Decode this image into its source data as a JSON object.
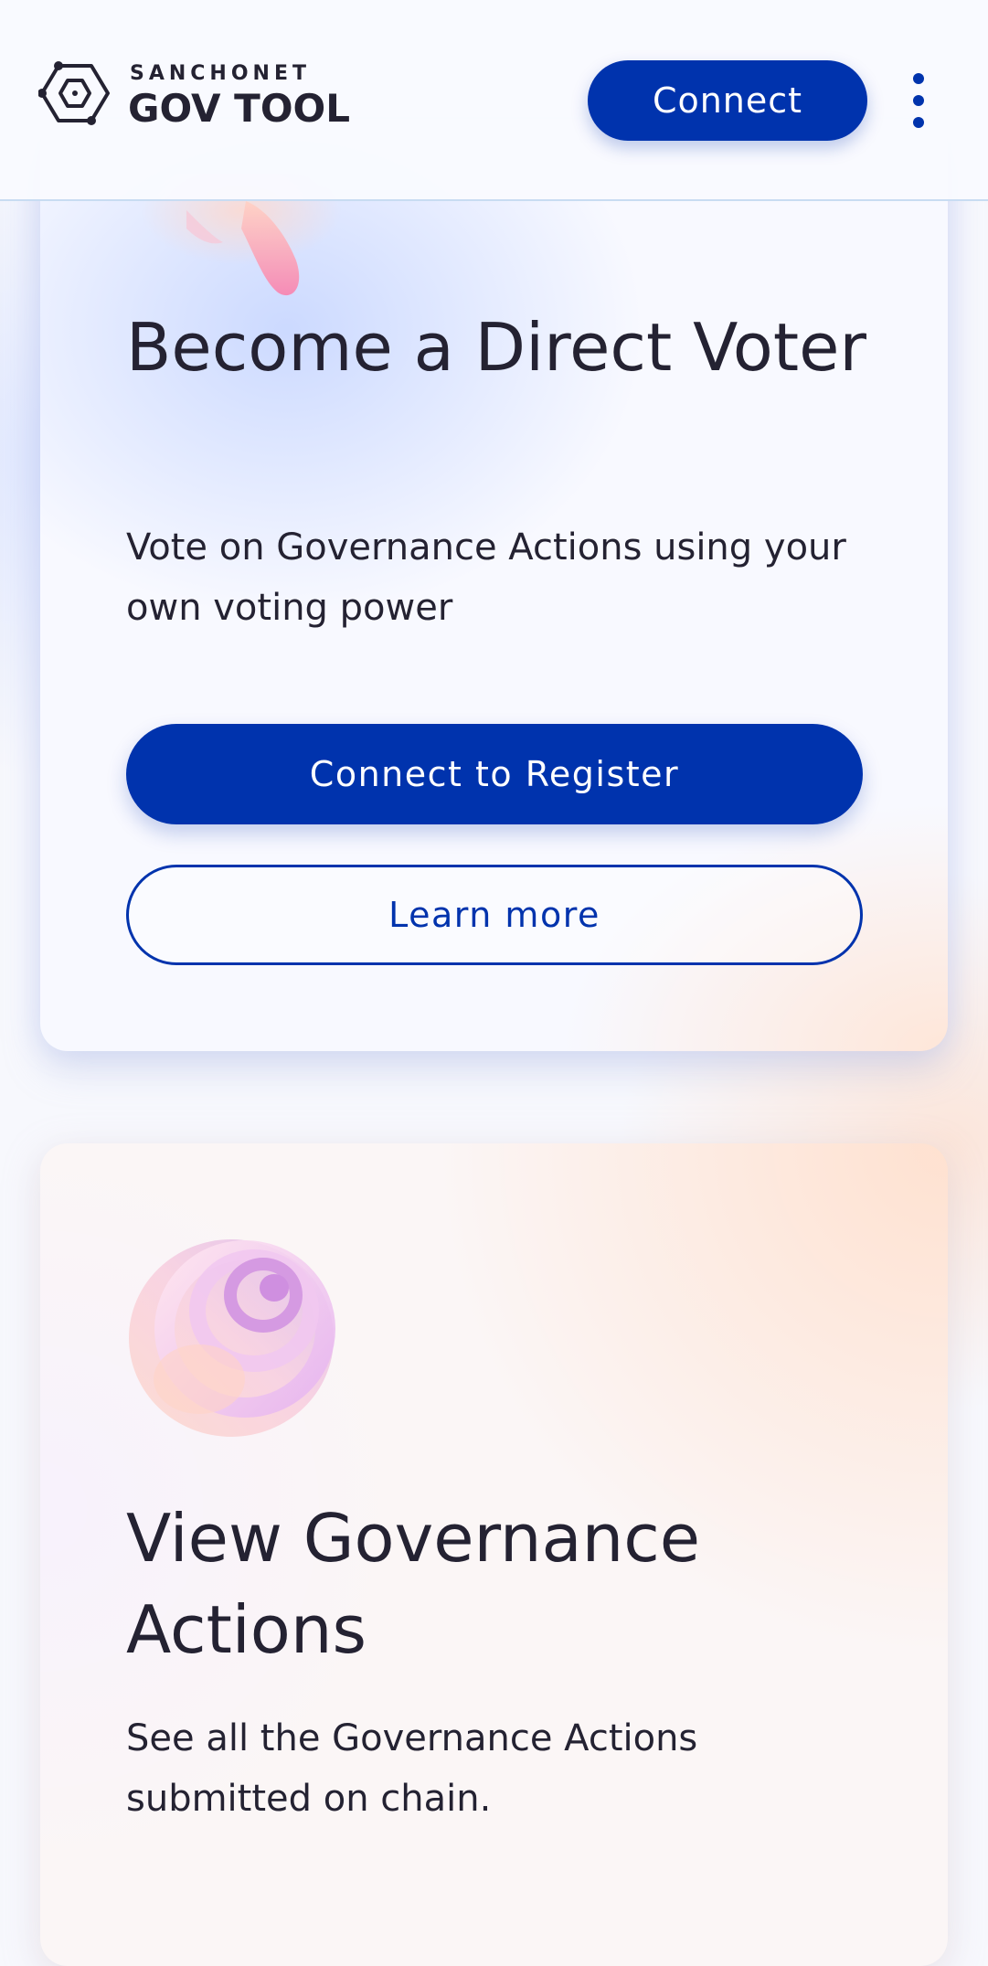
{
  "header": {
    "logo": {
      "network_label": "SANCHONET",
      "app_name": "GOV TOOL",
      "icon": "govtool-logo-icon"
    },
    "connect_label": "Connect",
    "menu_icon": "vertical-dots-menu-icon"
  },
  "cards": [
    {
      "title": "Become a Direct Voter",
      "description": "Vote on Governance Actions using your own voting power",
      "primary_button": "Connect to Register",
      "secondary_button": "Learn more",
      "illustration": "pink-abstract-illustration"
    },
    {
      "title": "View Governance Actions",
      "description": "See all the Governance Actions submitted on chain.",
      "illustration": "spiral-illustration"
    }
  ],
  "colors": {
    "primary": "#0033ad",
    "text": "#242232",
    "background": "#f7f8fd"
  }
}
